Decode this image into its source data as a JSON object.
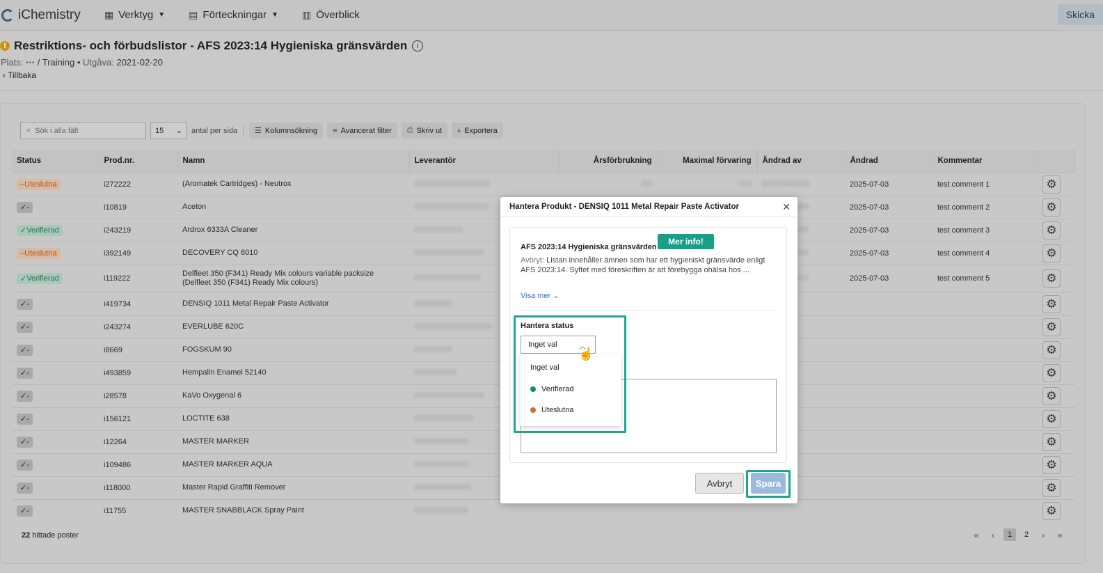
{
  "app": {
    "name": "iChemistry"
  },
  "nav": [
    {
      "label": "Verktyg",
      "icon": "grid-icon"
    },
    {
      "label": "Förteckningar",
      "icon": "list-icon"
    },
    {
      "label": "Överblick",
      "icon": "chart-icon"
    }
  ],
  "skicka": "Skicka",
  "page": {
    "title": "Restriktions- och förbudslistor - AFS 2023:14 Hygieniska gränsvärden",
    "plats_label": "Plats:",
    "plats_path": "/ Training",
    "utgava_label": "Utgåva:",
    "utgava_value": "2021-02-20",
    "back": "Tillbaka"
  },
  "toolbar": {
    "search_placeholder": "Sök i alla fält",
    "per_page": "15",
    "per_page_label": "antal per sida",
    "kolumnsokning": "Kolumnsökning",
    "avancerat": "Avancerat filter",
    "skriv_ut": "Skriv ut",
    "exportera": "Exportera"
  },
  "columns": [
    "Status",
    "Prod.nr.",
    "Namn",
    "Leverantör",
    "Årsförbrukning",
    "Maximal förvaring",
    "Ändrad av",
    "Ändrad",
    "Kommentar"
  ],
  "rows": [
    {
      "status": "Uteslutna",
      "kind": "ut",
      "prod": "i272222",
      "name": "(Aromatek Cartridges) - Neutrox",
      "date": "2025-07-03",
      "comment": "test comment 1"
    },
    {
      "status": "-",
      "kind": "no",
      "prod": "i10819",
      "name": "Aceton",
      "date": "2025-07-03",
      "comment": "test comment 2"
    },
    {
      "status": "Verifierad",
      "kind": "ve",
      "prod": "i243219",
      "name": "Ardrox 6333A Cleaner",
      "date": "2025-07-03",
      "comment": "test comment 3"
    },
    {
      "status": "Uteslutna",
      "kind": "ut",
      "prod": "i392149",
      "name": "DECOVERY CQ 6010",
      "date": "2025-07-03",
      "comment": "test comment 4"
    },
    {
      "status": "Verifierad",
      "kind": "ve",
      "prod": "i119222",
      "name": "Delfleet 350 (F341) Ready Mix colours variable packsize (Delfleet 350 (F341) Ready Mix colours)",
      "date": "2025-07-03",
      "comment": "test comment 5"
    },
    {
      "status": "-",
      "kind": "no",
      "prod": "i419734",
      "name": "DENSIQ 1011 Metal Repair Paste Activator",
      "date": "",
      "comment": ""
    },
    {
      "status": "-",
      "kind": "no",
      "prod": "i243274",
      "name": "EVERLUBE 620C",
      "date": "",
      "comment": ""
    },
    {
      "status": "-",
      "kind": "no",
      "prod": "i8669",
      "name": "FOGSKUM 90",
      "date": "",
      "comment": ""
    },
    {
      "status": "-",
      "kind": "no",
      "prod": "i493859",
      "name": "Hempalin Enamel 52140",
      "date": "",
      "comment": ""
    },
    {
      "status": "-",
      "kind": "no",
      "prod": "i28578",
      "name": "KaVo Oxygenal 6",
      "date": "",
      "comment": ""
    },
    {
      "status": "-",
      "kind": "no",
      "prod": "i156121",
      "name": "LOCTITE 638",
      "date": "",
      "comment": ""
    },
    {
      "status": "-",
      "kind": "no",
      "prod": "i12264",
      "name": "MASTER MARKER",
      "date": "",
      "comment": ""
    },
    {
      "status": "-",
      "kind": "no",
      "prod": "i109486",
      "name": "MASTER MARKER AQUA",
      "date": "",
      "comment": ""
    },
    {
      "status": "-",
      "kind": "no",
      "prod": "i118000",
      "name": "Master Rapid Graffiti Remover",
      "date": "",
      "comment": ""
    },
    {
      "status": "-",
      "kind": "no",
      "prod": "i11755",
      "name": "MASTER SNABBLACK Spray Paint",
      "date": "",
      "comment": ""
    }
  ],
  "footer": {
    "count": "22",
    "count_label": "hittade poster",
    "pages": [
      "1",
      "2"
    ]
  },
  "modal": {
    "title": "Hantera Produkt - DENSIQ 1011 Metal Repair Paste Activator",
    "list_title": "AFS 2023:14 Hygieniska gränsvärden",
    "mer_info": "Mer info!",
    "desc_label": "Avbryt:",
    "desc": "Listan innehåller ämnen som har ett hygieniskt gränsvärde enligt AFS 2023:14. Syftet med föreskriften är att förebygga ohälsa hos ...",
    "visa_mer": "Visa mer",
    "hantera_status": "Hantera status",
    "selected": "Inget val",
    "options": [
      {
        "label": "Inget val",
        "color": ""
      },
      {
        "label": "Verifierad",
        "color": "#12915f"
      },
      {
        "label": "Uteslutna",
        "color": "#d0693a"
      }
    ],
    "cancel": "Avbryt",
    "save": "Spara"
  }
}
